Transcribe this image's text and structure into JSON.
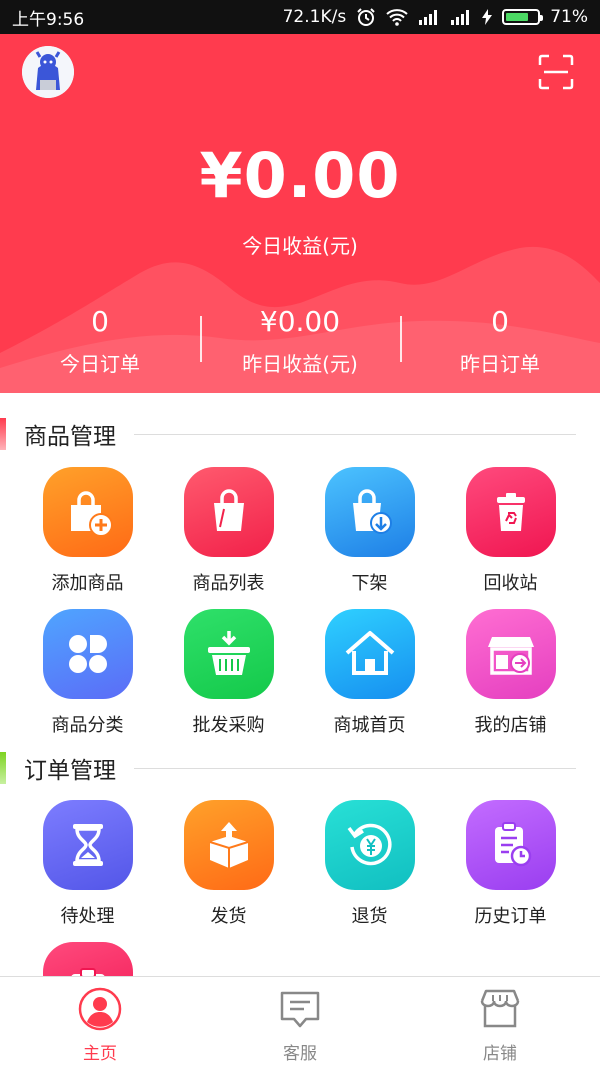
{
  "status_bar": {
    "time": "上午9:56",
    "net_speed": "72.1K/s",
    "battery_percent": "71%",
    "battery_level": 0.71,
    "battery_color": "#4cd964"
  },
  "hero": {
    "background": "#ff3b4e",
    "avatar_icon": "avatar-image",
    "scan_icon": "scan-icon",
    "today_income_amount": "¥0.00",
    "today_income_label": "今日收益(元)",
    "stats": [
      {
        "value": "0",
        "label": "今日订单"
      },
      {
        "value": "¥0.00",
        "label": "昨日收益(元)"
      },
      {
        "value": "0",
        "label": "昨日订单"
      }
    ]
  },
  "goods_section": {
    "title": "商品管理",
    "accent": "#ff3b4e",
    "items": [
      {
        "label": "添加商品",
        "icon": "bag-add-icon"
      },
      {
        "label": "商品列表",
        "icon": "bag-icon"
      },
      {
        "label": "下架",
        "icon": "bag-down-icon"
      },
      {
        "label": "回收站",
        "icon": "recycle-bin-icon"
      },
      {
        "label": "商品分类",
        "icon": "category-icon"
      },
      {
        "label": "批发采购",
        "icon": "basket-icon"
      },
      {
        "label": "商城首页",
        "icon": "home-icon"
      },
      {
        "label": "我的店铺",
        "icon": "store-icon"
      }
    ]
  },
  "orders_section": {
    "title": "订单管理",
    "accent": "#7ed321",
    "items": [
      {
        "label": "待处理",
        "icon": "hourglass-icon"
      },
      {
        "label": "发货",
        "icon": "package-icon"
      },
      {
        "label": "退货",
        "icon": "refund-icon"
      },
      {
        "label": "历史订单",
        "icon": "history-icon"
      }
    ]
  },
  "tabbar": {
    "tabs": [
      {
        "label": "主页",
        "icon": "user-home-icon",
        "active": true
      },
      {
        "label": "客服",
        "icon": "chat-icon",
        "active": false
      },
      {
        "label": "店铺",
        "icon": "shop-icon",
        "active": false
      }
    ]
  }
}
